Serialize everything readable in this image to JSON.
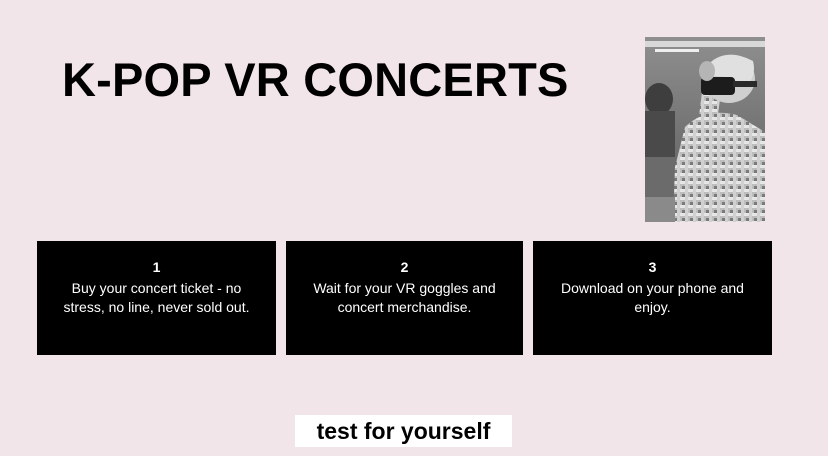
{
  "header": {
    "title": "K-POP VR CONCERTS"
  },
  "photo": {
    "icon": "vr-headset-photo"
  },
  "steps": [
    {
      "number": "1",
      "text": "Buy your concert ticket - no stress, no line, never sold out."
    },
    {
      "number": "2",
      "text": "Wait for your VR goggles and concert merchandise."
    },
    {
      "number": "3",
      "text": "Download on your phone and enjoy."
    }
  ],
  "cta": {
    "label": "test for yourself"
  },
  "colors": {
    "background": "#f1e5e9",
    "card": "#000000",
    "card_text": "#ffffff",
    "button_bg": "#ffffff"
  }
}
